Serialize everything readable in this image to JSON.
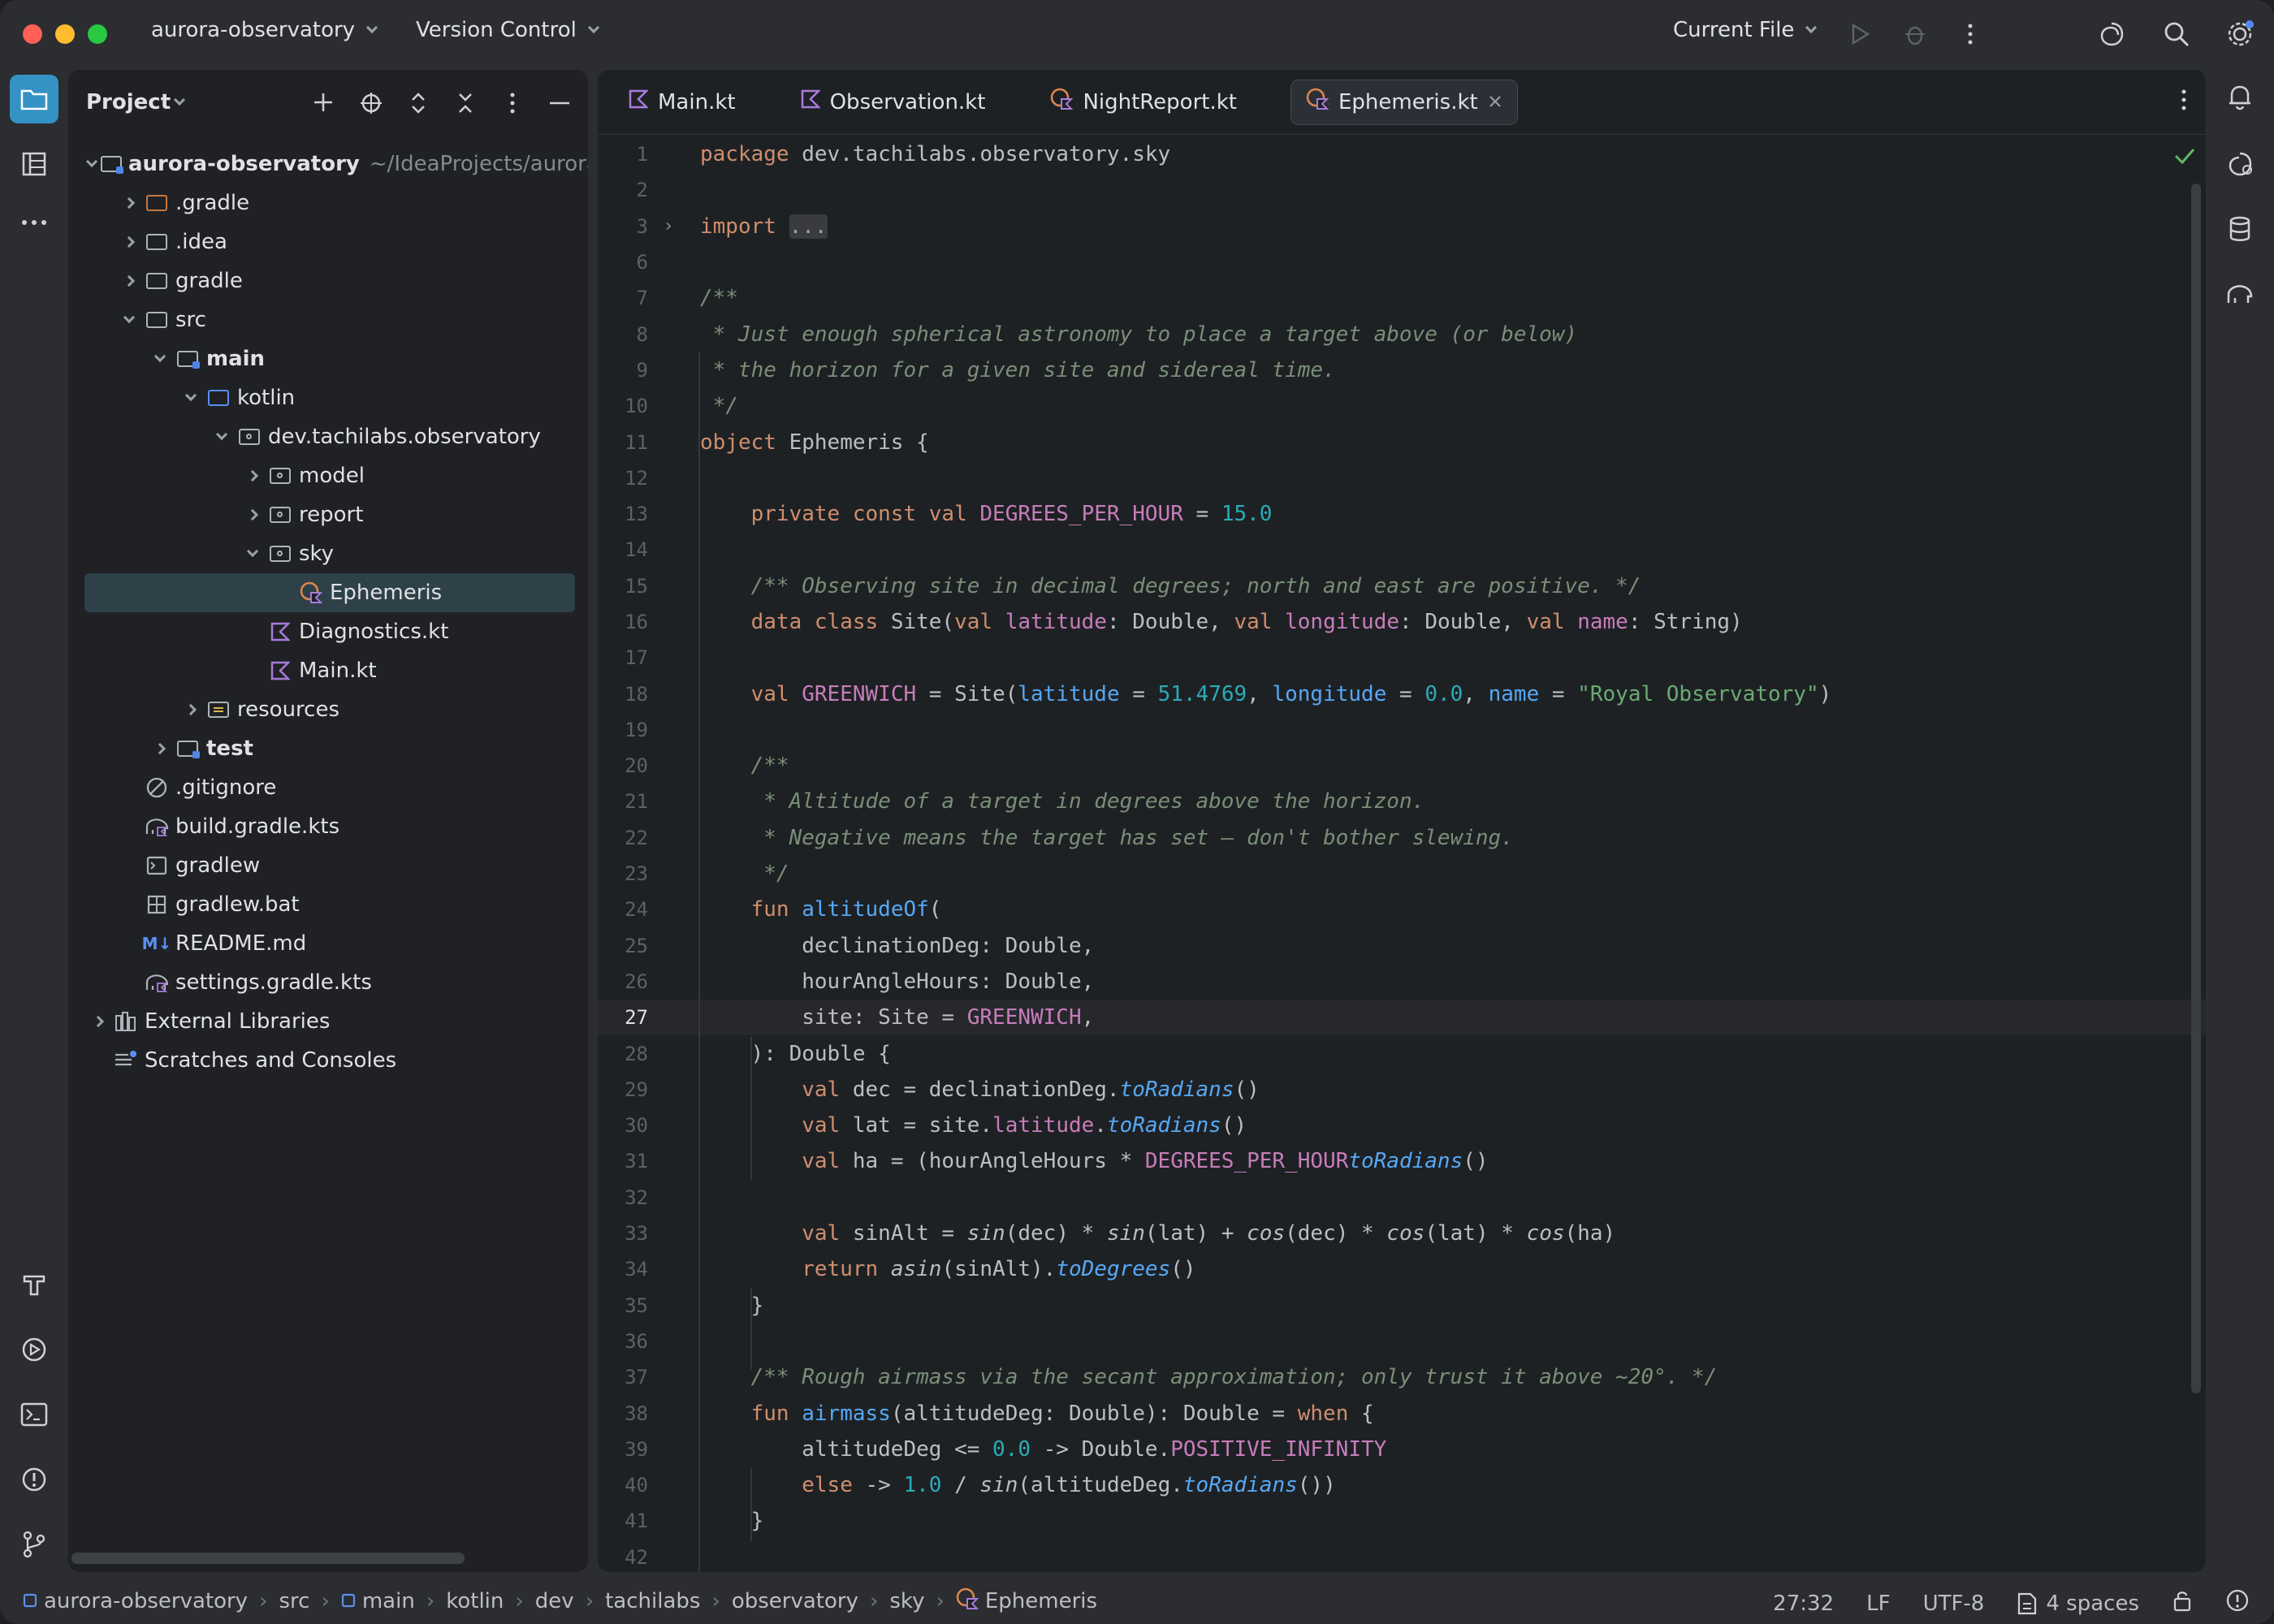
{
  "window": {
    "project_name": "aurora-observatory",
    "vcs_label": "Version Control",
    "run_config": "Current File"
  },
  "colors": {
    "accent": "#3592c4",
    "selection": "#2e4048",
    "keyword": "#cf8e6d",
    "comment": "#7a8e78",
    "number": "#2aacb8",
    "string": "#6aab73",
    "property": "#c77dbb",
    "function": "#56a8f5"
  },
  "project_panel": {
    "title": "Project",
    "tree": [
      {
        "label": "aurora-observatory",
        "extra": "~/IdeaProjects/aurora-",
        "depth": 0,
        "arrow": "down",
        "icon": "module-folder",
        "bold": true
      },
      {
        "label": ".gradle",
        "depth": 1,
        "arrow": "right",
        "icon": "folder-orange"
      },
      {
        "label": ".idea",
        "depth": 1,
        "arrow": "right",
        "icon": "folder"
      },
      {
        "label": "gradle",
        "depth": 1,
        "arrow": "right",
        "icon": "folder"
      },
      {
        "label": "src",
        "depth": 1,
        "arrow": "down",
        "icon": "folder"
      },
      {
        "label": "main",
        "depth": 2,
        "arrow": "down",
        "icon": "module-folder",
        "bold": true
      },
      {
        "label": "kotlin",
        "depth": 3,
        "arrow": "down",
        "icon": "folder-blue"
      },
      {
        "label": "dev.tachilabs.observatory",
        "depth": 4,
        "arrow": "down",
        "icon": "package"
      },
      {
        "label": "model",
        "depth": 5,
        "arrow": "right",
        "icon": "package"
      },
      {
        "label": "report",
        "depth": 5,
        "arrow": "right",
        "icon": "package"
      },
      {
        "label": "sky",
        "depth": 5,
        "arrow": "down",
        "icon": "package"
      },
      {
        "label": "Ephemeris",
        "depth": 6,
        "arrow": "none",
        "icon": "kotlin-object",
        "selected": true
      },
      {
        "label": "Diagnostics.kt",
        "depth": 5,
        "arrow": "none",
        "icon": "kotlin-file"
      },
      {
        "label": "Main.kt",
        "depth": 5,
        "arrow": "none",
        "icon": "kotlin-file"
      },
      {
        "label": "resources",
        "depth": 3,
        "arrow": "right",
        "icon": "resources-folder"
      },
      {
        "label": "test",
        "depth": 2,
        "arrow": "right",
        "icon": "module-folder",
        "bold": true
      },
      {
        "label": ".gitignore",
        "depth": 1,
        "arrow": "none",
        "icon": "ignore-file"
      },
      {
        "label": "build.gradle.kts",
        "depth": 1,
        "arrow": "none",
        "icon": "gradle-file"
      },
      {
        "label": "gradlew",
        "depth": 1,
        "arrow": "none",
        "icon": "shell-file"
      },
      {
        "label": "gradlew.bat",
        "depth": 1,
        "arrow": "none",
        "icon": "bat-file"
      },
      {
        "label": "README.md",
        "depth": 1,
        "arrow": "none",
        "icon": "markdown-file"
      },
      {
        "label": "settings.gradle.kts",
        "depth": 1,
        "arrow": "none",
        "icon": "gradle-file"
      },
      {
        "label": "External Libraries",
        "depth": 0,
        "arrow": "right",
        "icon": "libraries"
      },
      {
        "label": "Scratches and Consoles",
        "depth": 0,
        "arrow": "none",
        "icon": "scratches"
      }
    ]
  },
  "tabs": [
    {
      "label": "Main.kt",
      "icon": "kotlin-file",
      "active": false
    },
    {
      "label": "Observation.kt",
      "icon": "kotlin-file",
      "active": false
    },
    {
      "label": "NightReport.kt",
      "icon": "kotlin-object",
      "active": false
    },
    {
      "label": "Ephemeris.kt",
      "icon": "kotlin-object",
      "active": true
    }
  ],
  "code": [
    {
      "n": "1",
      "tokens": [
        [
          "kw",
          "package "
        ],
        [
          "",
          "dev.tachilabs.observatory.sky"
        ]
      ]
    },
    {
      "n": "2",
      "tokens": []
    },
    {
      "n": "3",
      "fold": true,
      "tokens": [
        [
          "kw",
          "import "
        ],
        [
          "fold",
          "..."
        ]
      ]
    },
    {
      "n": "6",
      "tokens": []
    },
    {
      "n": "7",
      "tokens": [
        [
          "cm",
          "/**"
        ]
      ]
    },
    {
      "n": "8",
      "tokens": [
        [
          "cm",
          " * Just enough spherical astronomy to place a target above (or below)"
        ]
      ]
    },
    {
      "n": "9",
      "tokens": [
        [
          "cm",
          " * the horizon for a given site and sidereal time."
        ]
      ]
    },
    {
      "n": "10",
      "tokens": [
        [
          "cm",
          " */"
        ]
      ]
    },
    {
      "n": "11",
      "tokens": [
        [
          "kw",
          "object "
        ],
        [
          "",
          "Ephemeris {"
        ]
      ]
    },
    {
      "n": "12",
      "tokens": []
    },
    {
      "n": "13",
      "tokens": [
        [
          "",
          "    "
        ],
        [
          "kw",
          "private const val "
        ],
        [
          "prop",
          "DEGREES_PER_HOUR"
        ],
        [
          "",
          " = "
        ],
        [
          "num",
          "15.0"
        ]
      ]
    },
    {
      "n": "14",
      "tokens": []
    },
    {
      "n": "15",
      "tokens": [
        [
          "",
          "    "
        ],
        [
          "cm",
          "/** Observing site in decimal degrees; north and east are positive. */"
        ]
      ]
    },
    {
      "n": "16",
      "tokens": [
        [
          "",
          "    "
        ],
        [
          "kw",
          "data class "
        ],
        [
          "",
          "Site("
        ],
        [
          "kw",
          "val "
        ],
        [
          "prop",
          "latitude"
        ],
        [
          "",
          ": Double, "
        ],
        [
          "kw",
          "val "
        ],
        [
          "prop",
          "longitude"
        ],
        [
          "",
          ": Double, "
        ],
        [
          "kw",
          "val "
        ],
        [
          "prop",
          "name"
        ],
        [
          "",
          ": String)"
        ]
      ]
    },
    {
      "n": "17",
      "tokens": []
    },
    {
      "n": "18",
      "tokens": [
        [
          "",
          "    "
        ],
        [
          "kw",
          "val "
        ],
        [
          "prop",
          "GREENWICH"
        ],
        [
          "",
          " = Site("
        ],
        [
          "fnp",
          "latitude"
        ],
        [
          "",
          " = "
        ],
        [
          "num",
          "51.4769"
        ],
        [
          "",
          ", "
        ],
        [
          "fnp",
          "longitude"
        ],
        [
          "",
          " = "
        ],
        [
          "num",
          "0.0"
        ],
        [
          "",
          ", "
        ],
        [
          "fnp",
          "name"
        ],
        [
          "",
          " = "
        ],
        [
          "str",
          "\"Royal Observatory\""
        ],
        [
          "",
          ")"
        ]
      ]
    },
    {
      "n": "19",
      "tokens": []
    },
    {
      "n": "20",
      "tokens": [
        [
          "",
          "    "
        ],
        [
          "cm",
          "/**"
        ]
      ]
    },
    {
      "n": "21",
      "tokens": [
        [
          "",
          "    "
        ],
        [
          "cm",
          " * Altitude of a target in degrees above the horizon."
        ]
      ]
    },
    {
      "n": "22",
      "tokens": [
        [
          "",
          "    "
        ],
        [
          "cm",
          " * Negative means the target has set — don't bother slewing."
        ]
      ]
    },
    {
      "n": "23",
      "tokens": [
        [
          "",
          "    "
        ],
        [
          "cm",
          " */"
        ]
      ]
    },
    {
      "n": "24",
      "tokens": [
        [
          "",
          "    "
        ],
        [
          "kw",
          "fun "
        ],
        [
          "fn",
          "altitudeOf"
        ],
        [
          "",
          "("
        ]
      ]
    },
    {
      "n": "25",
      "tokens": [
        [
          "",
          "        declinationDeg: Double,"
        ]
      ]
    },
    {
      "n": "26",
      "tokens": [
        [
          "",
          "        hourAngleHours: Double,"
        ]
      ]
    },
    {
      "n": "27",
      "current": true,
      "tokens": [
        [
          "",
          "        site: Site = "
        ],
        [
          "prop",
          "GREENWICH"
        ],
        [
          "",
          ","
        ]
      ]
    },
    {
      "n": "28",
      "tokens": [
        [
          "",
          "    ): Double {"
        ]
      ]
    },
    {
      "n": "29",
      "tokens": [
        [
          "",
          "        "
        ],
        [
          "kw",
          "val "
        ],
        [
          "",
          "dec = declinationDeg."
        ],
        [
          "itfn",
          "toRadians"
        ],
        [
          "",
          "()"
        ]
      ]
    },
    {
      "n": "30",
      "tokens": [
        [
          "",
          "        "
        ],
        [
          "kw",
          "val "
        ],
        [
          "",
          "lat = site."
        ],
        [
          "prop",
          "latitude"
        ],
        [
          "",
          "."
        ],
        [
          "itfn",
          "toRadians"
        ],
        [
          "",
          "()"
        ]
      ]
    },
    {
      "n": "31",
      "tokens": [
        [
          "",
          "        "
        ],
        [
          "kw",
          "val "
        ],
        [
          "",
          "ha = (hourAngleHours * "
        ],
        [
          "prop",
          "DEGREES_PER_HOUR"
        ],
        [
          ").",
          ""
        ],
        [
          "itfn",
          "toRadians"
        ],
        [
          "",
          "()"
        ]
      ]
    },
    {
      "n": "32",
      "tokens": []
    },
    {
      "n": "33",
      "tokens": [
        [
          "",
          "        "
        ],
        [
          "kw",
          "val "
        ],
        [
          "",
          "sinAlt = "
        ],
        [
          "ital",
          "sin"
        ],
        [
          "",
          "(dec) * "
        ],
        [
          "ital",
          "sin"
        ],
        [
          "",
          "(lat) + "
        ],
        [
          "ital",
          "cos"
        ],
        [
          "",
          "(dec) * "
        ],
        [
          "ital",
          "cos"
        ],
        [
          "",
          "(lat) * "
        ],
        [
          "ital",
          "cos"
        ],
        [
          "",
          "(ha)"
        ]
      ]
    },
    {
      "n": "34",
      "tokens": [
        [
          "",
          "        "
        ],
        [
          "kw",
          "return "
        ],
        [
          "ital",
          "asin"
        ],
        [
          "",
          "(sinAlt)."
        ],
        [
          "itfn",
          "toDegrees"
        ],
        [
          "",
          "()"
        ]
      ]
    },
    {
      "n": "35",
      "tokens": [
        [
          "",
          "    }"
        ]
      ]
    },
    {
      "n": "36",
      "tokens": []
    },
    {
      "n": "37",
      "tokens": [
        [
          "",
          "    "
        ],
        [
          "cm",
          "/** Rough airmass via the secant approximation; only trust it above ~20°. */"
        ]
      ]
    },
    {
      "n": "38",
      "tokens": [
        [
          "",
          "    "
        ],
        [
          "kw",
          "fun "
        ],
        [
          "fn",
          "airmass"
        ],
        [
          "",
          "(altitudeDeg: Double): Double = "
        ],
        [
          "kw",
          "when "
        ],
        [
          "",
          "{"
        ]
      ]
    },
    {
      "n": "39",
      "tokens": [
        [
          "",
          "        altitudeDeg <= "
        ],
        [
          "num",
          "0.0"
        ],
        [
          "",
          " -> Double."
        ],
        [
          "prop",
          "POSITIVE_INFINITY"
        ]
      ]
    },
    {
      "n": "40",
      "tokens": [
        [
          "",
          "        "
        ],
        [
          "kw",
          "else "
        ],
        [
          "",
          "-> "
        ],
        [
          "num",
          "1.0"
        ],
        [
          "",
          " / "
        ],
        [
          "ital",
          "sin"
        ],
        [
          "",
          "(altitudeDeg."
        ],
        [
          "itfn",
          "toRadians"
        ],
        [
          "",
          "())"
        ]
      ]
    },
    {
      "n": "41",
      "tokens": [
        [
          "",
          "    }"
        ]
      ]
    },
    {
      "n": "42",
      "tokens": []
    }
  ],
  "statusbar": {
    "breadcrumbs": [
      "aurora-observatory",
      "src",
      "main",
      "kotlin",
      "dev",
      "tachilabs",
      "observatory",
      "sky",
      "Ephemeris"
    ],
    "position": "27:32",
    "line_separator": "LF",
    "encoding": "UTF-8",
    "indent": "4 spaces"
  }
}
